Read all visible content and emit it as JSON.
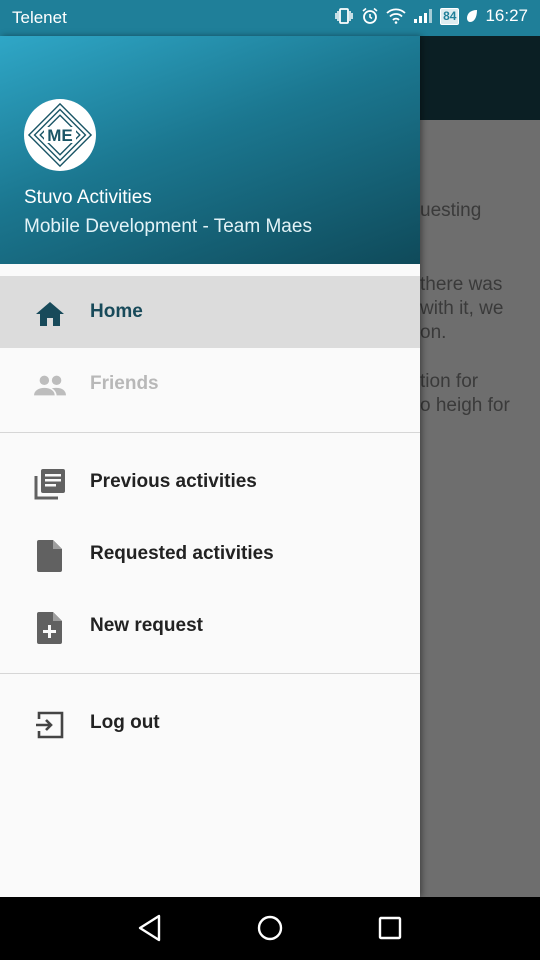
{
  "status_bar": {
    "carrier": "Telenet",
    "battery": "84",
    "time": "16:27"
  },
  "background_app": {
    "text_lines": [
      "uesting",
      "there was",
      "with it, we",
      "on.",
      "tion for",
      "o heigh for"
    ]
  },
  "drawer": {
    "header": {
      "logo_text": "ME",
      "app_name": "Stuvo Activities",
      "team_name": "Mobile Development - Team Maes"
    },
    "items": [
      {
        "label": "Home",
        "icon": "home-icon"
      },
      {
        "label": "Friends",
        "icon": "people-icon"
      },
      {
        "label": "Previous activities",
        "icon": "list-icon"
      },
      {
        "label": "Requested activities",
        "icon": "file-icon"
      },
      {
        "label": "New request",
        "icon": "file-plus-icon"
      },
      {
        "label": "Log out",
        "icon": "exit-icon"
      }
    ]
  },
  "colors": {
    "status_bar": "#1f7f99",
    "header_start": "#2fa7c7",
    "header_end": "#0f4a5a",
    "selected_text": "#184a5a",
    "selected_bg": "#dcdcdc"
  }
}
